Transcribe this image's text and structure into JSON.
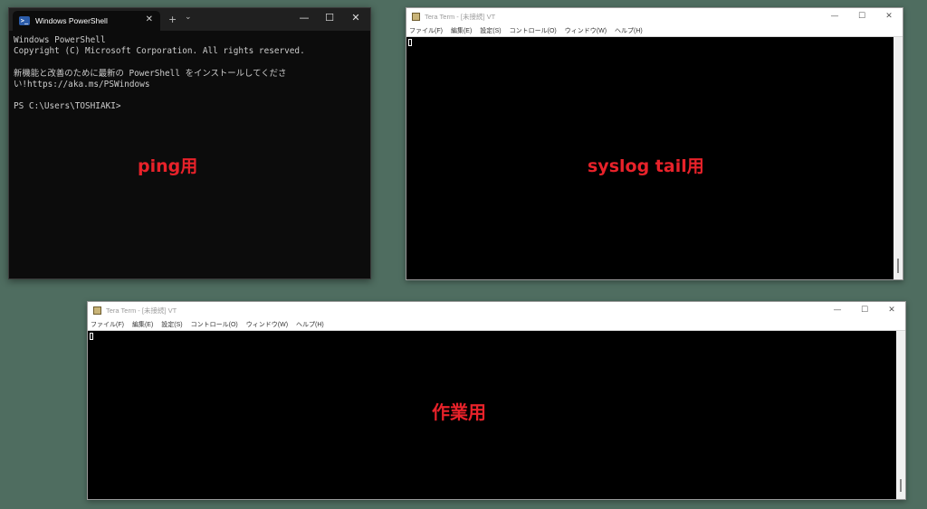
{
  "powershell": {
    "tab_title": "Windows PowerShell",
    "tab_icon": "powershell-icon",
    "close_tab": "✕",
    "new_tab": "+",
    "dropdown": "⌄",
    "minimize": "—",
    "maximize": "☐",
    "close": "✕",
    "lines": [
      "Windows PowerShell",
      "Copyright (C) Microsoft Corporation. All rights reserved.",
      "",
      "新機能と改善のために最新の PowerShell をインストールしてくださ",
      "い!https://aka.ms/PSWindows",
      "",
      "PS C:\\Users\\TOSHIAKI>"
    ],
    "label": "ping用"
  },
  "teraterm_top": {
    "title": "Tera Term - [未接続] VT",
    "menu": [
      "ファイル(F)",
      "編集(E)",
      "設定(S)",
      "コントロール(O)",
      "ウィンドウ(W)",
      "ヘルプ(H)"
    ],
    "minimize": "—",
    "maximize": "☐",
    "close": "✕",
    "label": "syslog tail用"
  },
  "teraterm_bottom": {
    "title": "Tera Term - [未接続] VT",
    "menu": [
      "ファイル(F)",
      "編集(E)",
      "設定(S)",
      "コントロール(O)",
      "ウィンドウ(W)",
      "ヘルプ(H)"
    ],
    "minimize": "—",
    "maximize": "☐",
    "close": "✕",
    "label": "作業用"
  },
  "colors": {
    "desktop": "#4f6d60",
    "label": "#e8222a"
  }
}
